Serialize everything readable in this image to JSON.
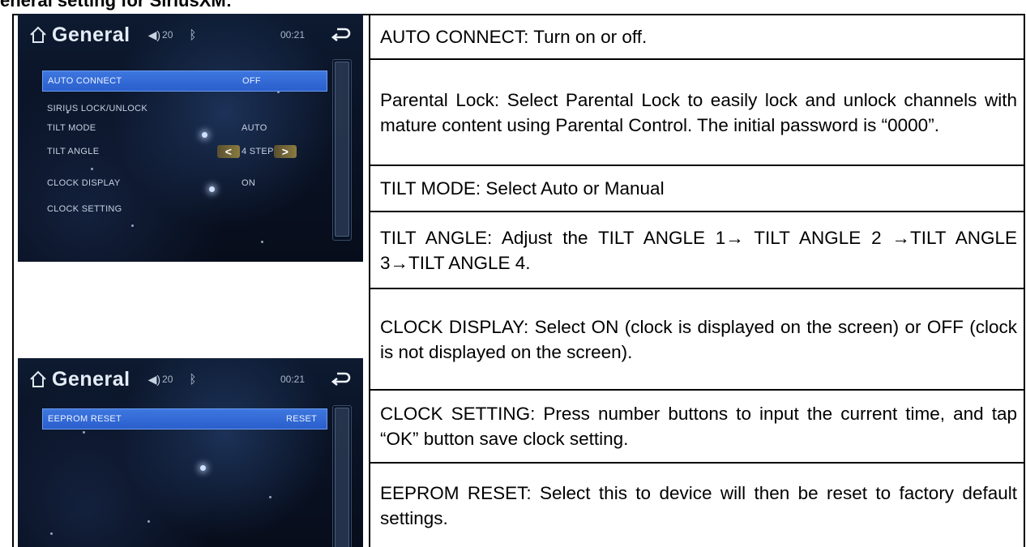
{
  "heading": "eneral setting for SiriusXM:",
  "screen1": {
    "title": "General",
    "volume": "20",
    "time": "00:21",
    "items": [
      {
        "label": "AUTO CONNECT",
        "value": "OFF",
        "selected": true
      },
      {
        "label": "SIRIUS LOCK/UNLOCK",
        "value": ""
      },
      {
        "label": "TILT MODE",
        "value": "AUTO"
      },
      {
        "label": "TILT ANGLE",
        "value": "4 STEP"
      },
      {
        "label": "CLOCK DISPLAY",
        "value": "ON"
      },
      {
        "label": "CLOCK SETTING",
        "value": ""
      }
    ]
  },
  "screen2": {
    "title": "General",
    "volume": "20",
    "time": "00:21",
    "items": [
      {
        "label": "EEPROM RESET",
        "value": "RESET",
        "selected": true
      }
    ]
  },
  "descriptions": [
    "AUTO CONNECT: Turn on or off.",
    "Parental Lock: Select Parental Lock to easily lock and unlock channels with mature content using Parental Control. The initial password is “0000”.",
    "TILT MODE: Select Auto or Manual",
    "TILT ANGLE: Adjust the TILT ANGLE 1→ TILT ANGLE 2 →TILT ANGLE 3→TILT ANGLE 4.",
    "CLOCK DISPLAY: Select ON (clock is displayed on the screen) or OFF (clock is not displayed on the screen).",
    "CLOCK SETTING: Press number buttons to input the current time, and tap “OK” button save clock setting.",
    "EEPROM RESET: Select this to device will then be reset to factory default settings."
  ],
  "colors": {
    "highlight": "#2f66d6",
    "screen_bg": "#0a1326"
  }
}
